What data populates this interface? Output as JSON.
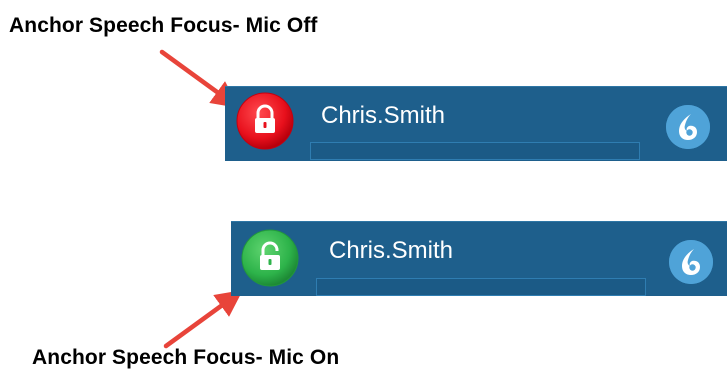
{
  "captions": {
    "mic_off": "Anchor Speech Focus- Mic Off",
    "mic_on": "Anchor Speech Focus- Mic On"
  },
  "bars": {
    "mic_off": {
      "username": "Chris.Smith",
      "anchor_state": "mic-off",
      "anchor_color": "#e8101c",
      "anchor_icon": "lock-icon"
    },
    "mic_on": {
      "username": "Chris.Smith",
      "anchor_state": "mic-on",
      "anchor_color": "#2db34a",
      "anchor_icon": "unlock-icon"
    }
  },
  "dragon_icon": "dragon-flame-icon",
  "colors": {
    "bar_background": "#1e5f8c",
    "arrow": "#e8443a",
    "dragon_button": "#4fa3d8"
  }
}
